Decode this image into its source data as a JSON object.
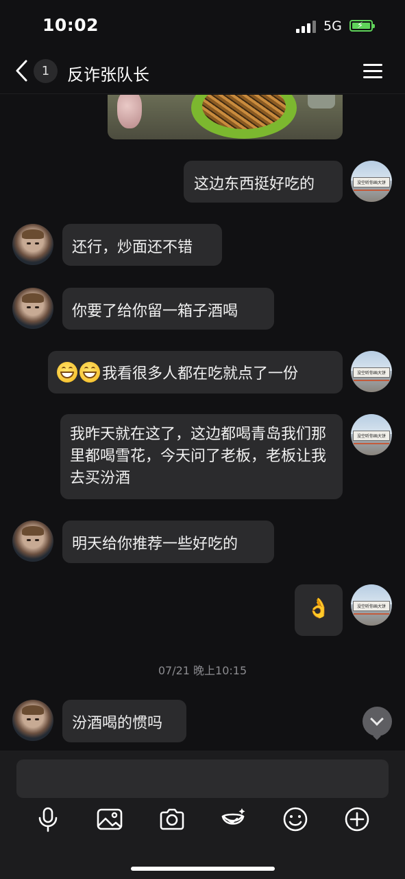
{
  "status_bar": {
    "time": "10:02",
    "network": "5G",
    "battery_color": "#5fd35a"
  },
  "nav": {
    "unread_badge": "1",
    "title": "反诈张队长",
    "back_icon": "chevron-left-icon",
    "menu_icon": "hamburger-menu-icon"
  },
  "contact_avatar_desc": "avatar",
  "my_avatar_sign": "没空听你画大饼",
  "messages": [
    {
      "side": "right",
      "text": "这边东西挺好吃的"
    },
    {
      "side": "left",
      "text": "还行，炒面还不错"
    },
    {
      "side": "left",
      "text": "你要了给你留一箱子酒喝"
    },
    {
      "side": "right",
      "emojis": "😁😁",
      "text": "我看很多人都在吃就点了一份"
    },
    {
      "side": "right",
      "text": "我昨天就在这了，这边都喝青岛我们那里都喝雪花，今天问了老板，老板让我去买汾酒"
    },
    {
      "side": "left",
      "text": "明天给你推荐一些好吃的"
    },
    {
      "side": "right",
      "text": "👌"
    },
    {
      "side": "left",
      "text": "汾酒喝的惯吗"
    }
  ],
  "timestamp": "07/21 晚上10:15",
  "toolbar": [
    "microphone-icon",
    "image-icon",
    "camera-icon",
    "sticker-icon",
    "emoji-icon",
    "plus-icon"
  ]
}
